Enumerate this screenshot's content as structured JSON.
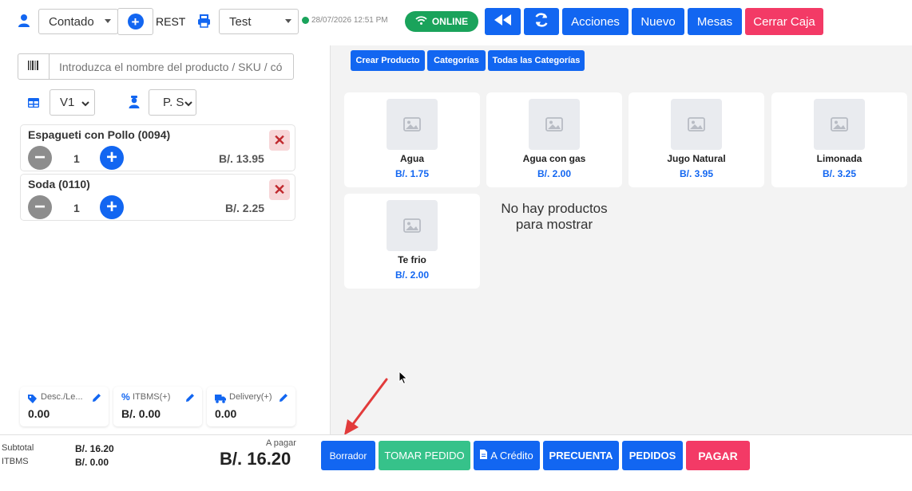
{
  "topbar": {
    "payment_type": "Contado",
    "mode_label": "REST",
    "printer": "Test",
    "timestamp": "28/07/2026 12:51 PM",
    "online_label": "ONLINE",
    "actions_label": "Acciones",
    "new_label": "Nuevo",
    "tables_label": "Mesas",
    "close_cash_label": "Cerrar Caja"
  },
  "search": {
    "placeholder": "Introduzca el nombre del producto / SKU / có"
  },
  "filters": {
    "table_value": "V1",
    "price_value": "P. So"
  },
  "cart": {
    "items": [
      {
        "name": "Espagueti con Pollo (0094)",
        "qty": "1",
        "price": "B/. 13.95"
      },
      {
        "name": "Soda (0110)",
        "qty": "1",
        "price": "B/. 2.25"
      }
    ]
  },
  "summary": {
    "discount_label": "Desc./Le...",
    "discount_value": "0.00",
    "itbms_label": "ITBMS(+)",
    "itbms_value": "B/. 0.00",
    "delivery_label": "Delivery(+)",
    "delivery_value": "0.00"
  },
  "product_tabs": {
    "create": "Crear Producto",
    "categories": "Categorías",
    "all_categories": "Todas las Categorías"
  },
  "products": [
    {
      "name": "Agua",
      "price": "B/. 1.75"
    },
    {
      "name": "Agua con gas",
      "price": "B/. 2.00"
    },
    {
      "name": "Jugo Natural",
      "price": "B/. 3.95"
    },
    {
      "name": "Limonada",
      "price": "B/. 3.25"
    },
    {
      "name": "Te frio",
      "price": "B/. 2.00"
    }
  ],
  "empty_message_line1": "No hay productos",
  "empty_message_line2": "para mostrar",
  "totals": {
    "subtotal_label": "Subtotal",
    "subtotal_value": "B/. 16.20",
    "itbms_label": "ITBMS",
    "itbms_value": "B/. 0.00",
    "to_pay_label": "A pagar",
    "to_pay_value": "B/. 16.20"
  },
  "bottom_buttons": {
    "draft": "Borrador",
    "take_order": "TOMAR PEDIDO",
    "credit": "A Crédito",
    "pre_bill": "PRECUENTA",
    "orders": "PEDIDOS",
    "pay": "PAGAR"
  },
  "colors": {
    "primary": "#1266f1",
    "danger": "#f33a66",
    "success": "#1aa35b",
    "take_order": "#36c28a"
  }
}
